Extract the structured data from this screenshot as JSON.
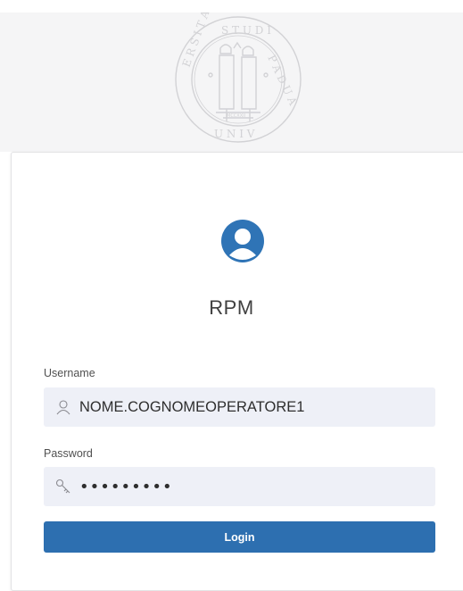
{
  "header": {
    "seal_icon": "university-seal-logo",
    "seal_text": "UNIVERSITAS STUDII PADUANI"
  },
  "login": {
    "avatar_icon": "user-avatar-icon",
    "app_title": "RPM",
    "username_label": "Username",
    "username_value": "NOME.COGNOMEOPERATORE1",
    "password_label": "Password",
    "password_value": "•••••••••",
    "login_button_label": "Login"
  },
  "colors": {
    "accent": "#2d6fb0",
    "avatar": "#2f74b6",
    "field_bg": "#eef0f7"
  }
}
